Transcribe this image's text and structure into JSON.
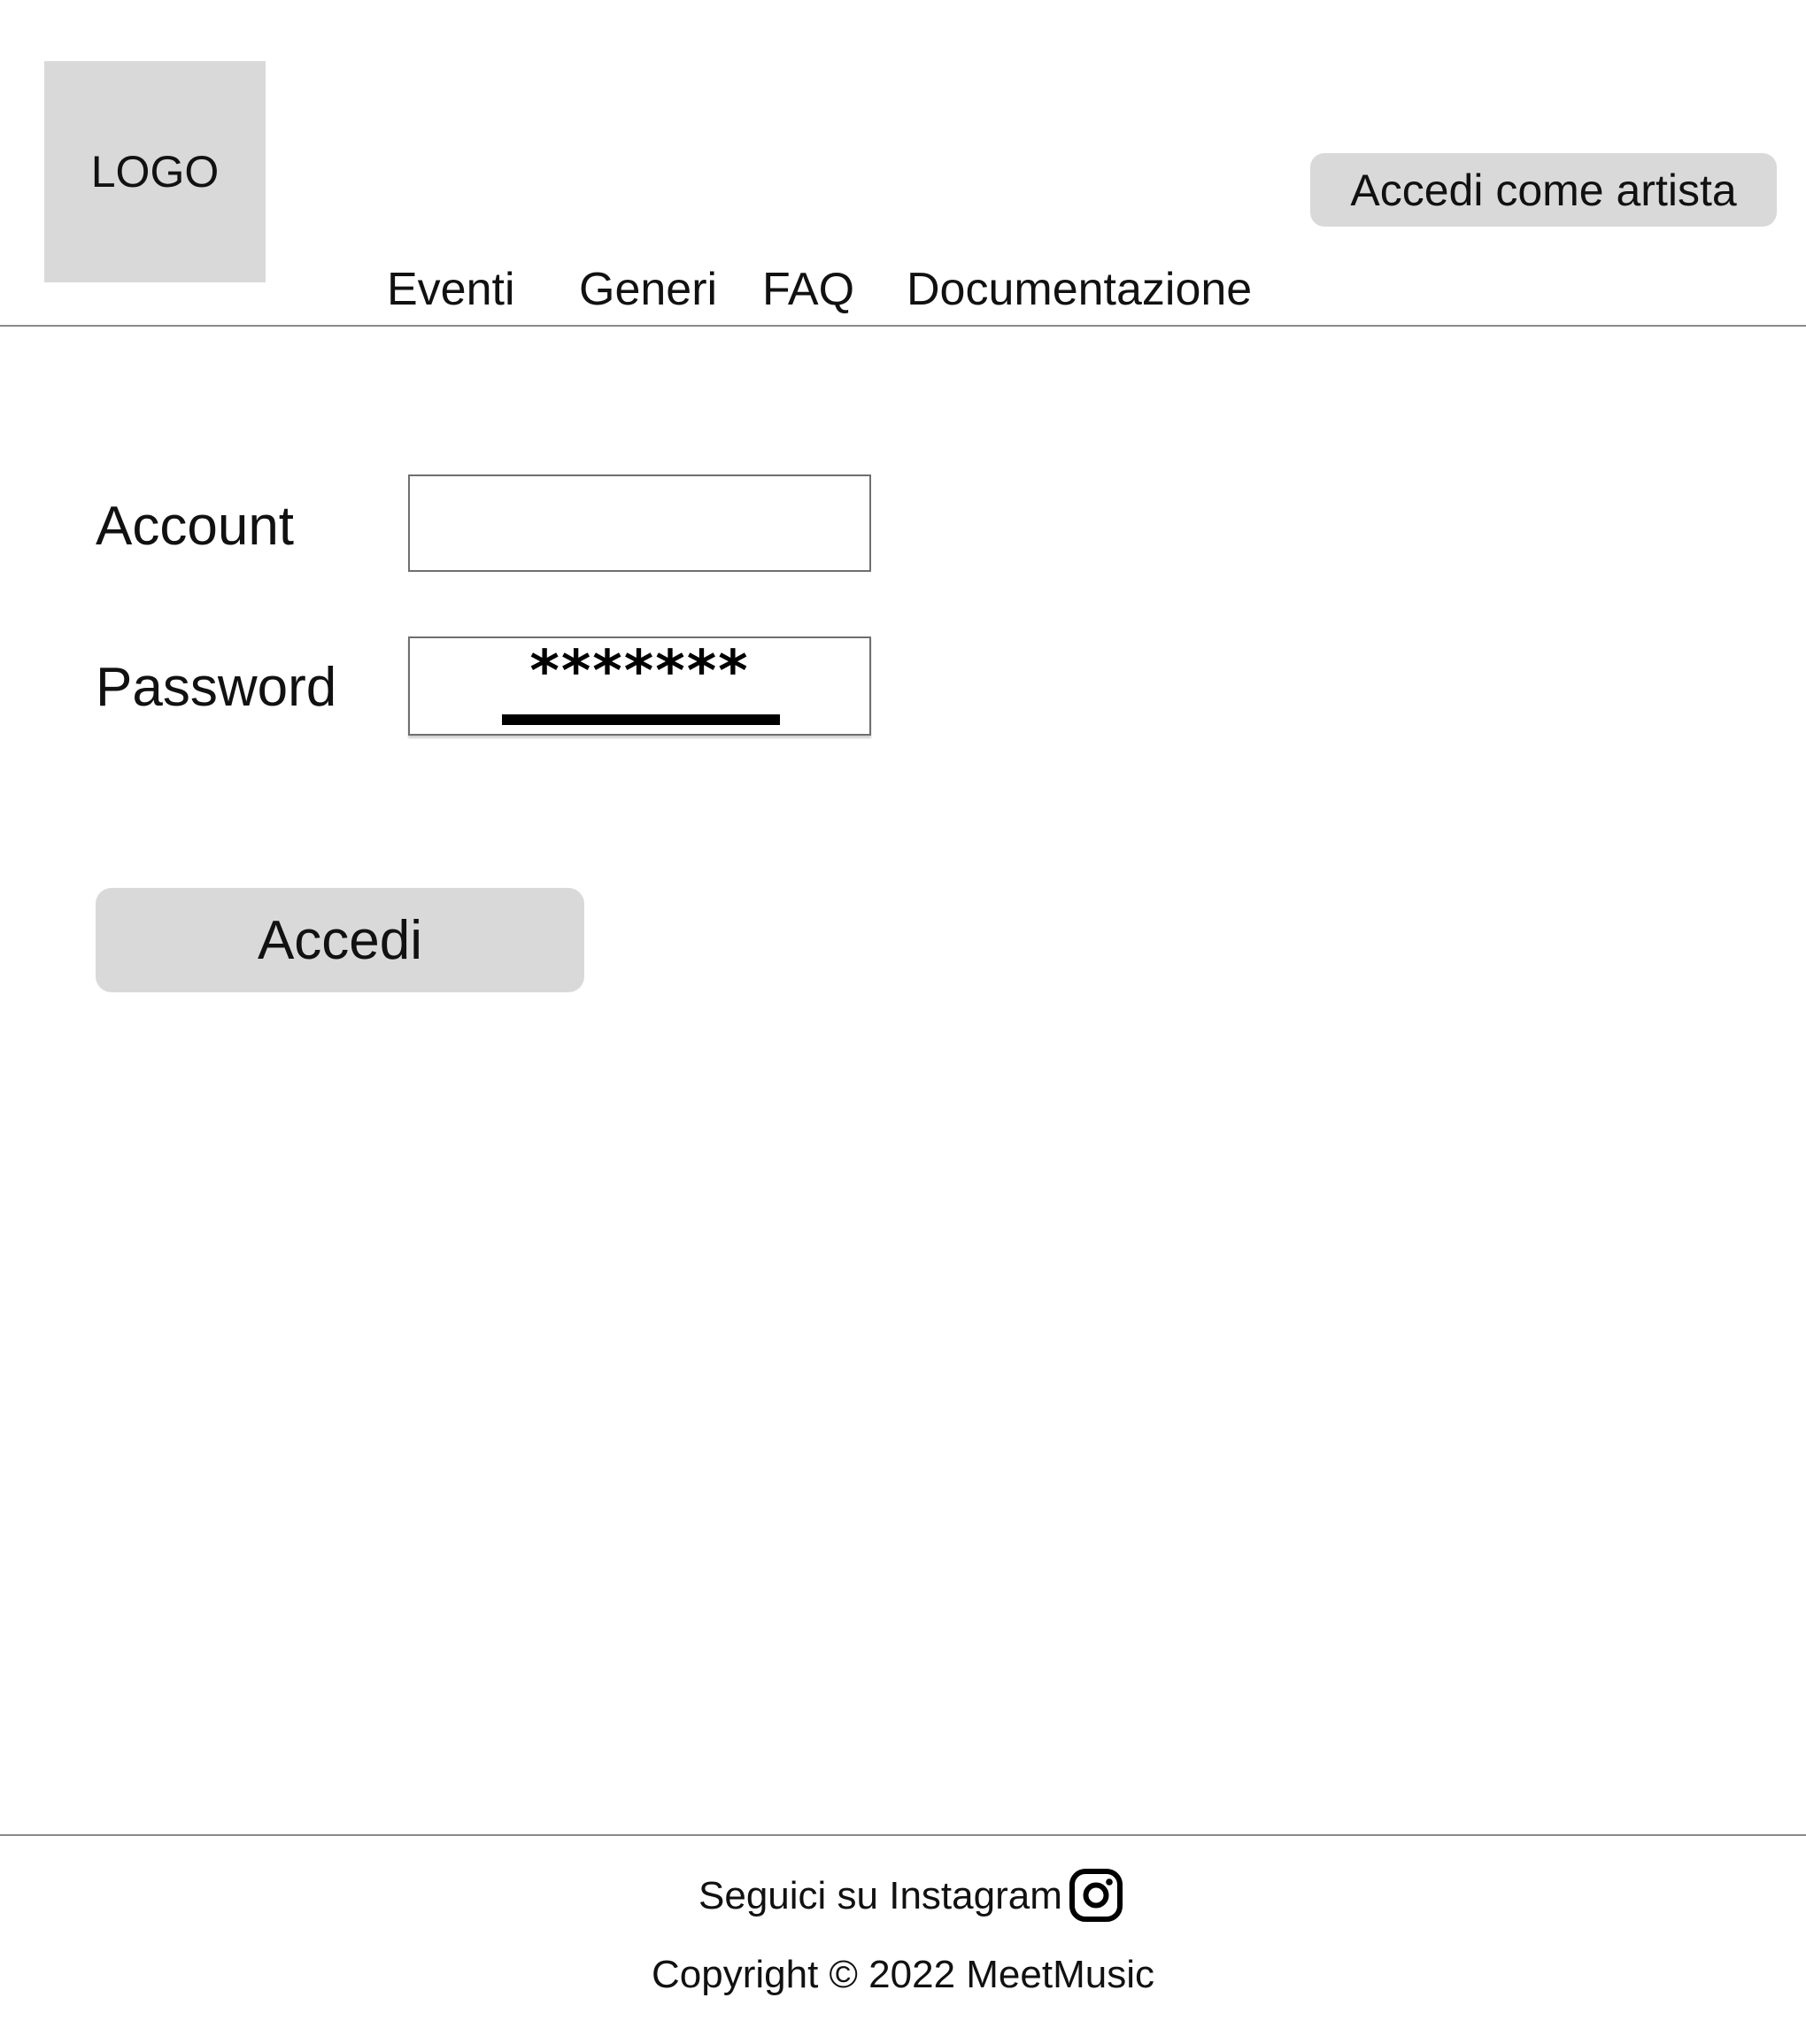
{
  "header": {
    "logo_text": "LOGO",
    "artist_login_label": "Accedi come artista",
    "nav": [
      {
        "label": "Eventi"
      },
      {
        "label": "Generi"
      },
      {
        "label": "FAQ"
      },
      {
        "label": "Documentazione"
      }
    ]
  },
  "form": {
    "account_label": "Account",
    "account_value": "",
    "password_label": "Password",
    "password_mask": "*******",
    "submit_label": "Accedi"
  },
  "footer": {
    "follow_text": "Seguici su Instagram",
    "follow_icon": "instagram-icon",
    "copyright": "Copyright © 2022 MeetMusic"
  },
  "colors": {
    "button_background": "#d9d9d9",
    "divider": "#8a8a8a",
    "text": "#111111"
  }
}
